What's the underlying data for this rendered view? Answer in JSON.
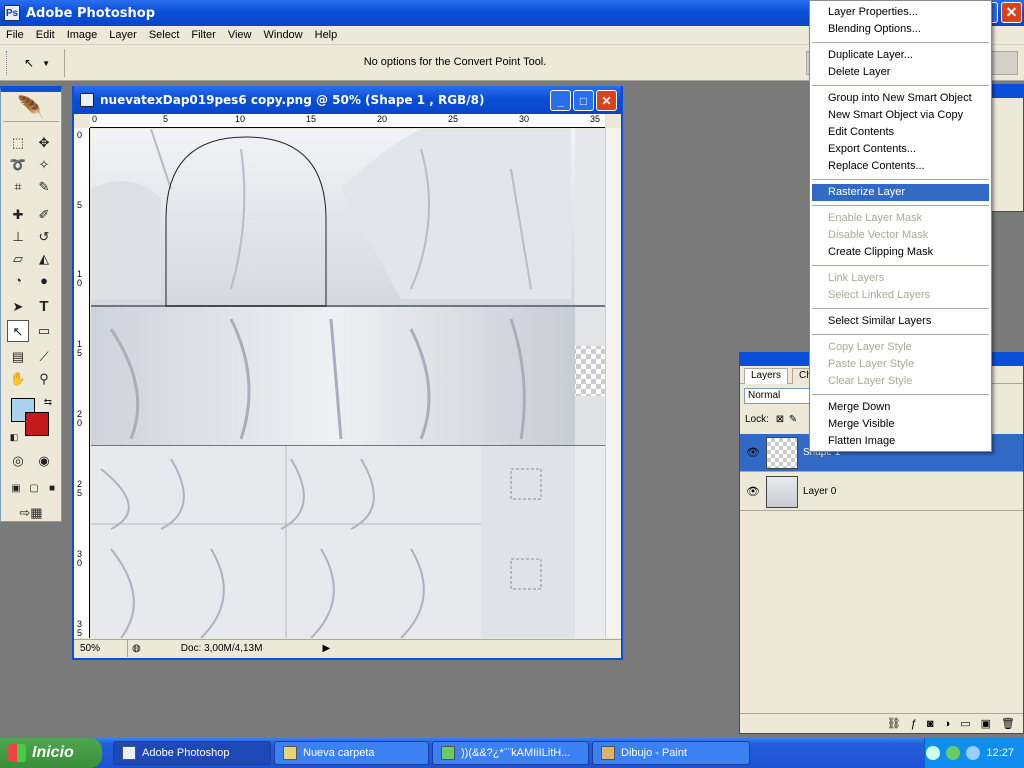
{
  "app": {
    "title": "Adobe Photoshop"
  },
  "menu": [
    "File",
    "Edit",
    "Image",
    "Layer",
    "Select",
    "Filter",
    "View",
    "Window",
    "Help"
  ],
  "options": {
    "message": "No options for the Convert Point Tool."
  },
  "document": {
    "title": "nuevatexDap019pes6 copy.png @ 50% (Shape 1 , RGB/8)",
    "zoom": "50%",
    "doc_size": "Doc: 3,00M/4,13M",
    "ruler_top": [
      "0",
      "5",
      "10",
      "15",
      "20",
      "25",
      "30",
      "35"
    ],
    "ruler_left": [
      "0",
      "5",
      "1\n0",
      "1\n5",
      "2\n0",
      "2\n5",
      "3\n0",
      "3\n5"
    ]
  },
  "colors": {
    "foreground": "#a8d4f0",
    "background": "#c41a1a"
  },
  "layers_panel": {
    "tabs": [
      "Layers",
      "Ch"
    ],
    "blend_mode": "Normal",
    "lock_label": "Lock:",
    "layers": [
      {
        "name": "Shape 1",
        "selected": true
      },
      {
        "name": "Layer 0",
        "selected": false
      }
    ]
  },
  "context_menu": {
    "items": [
      {
        "label": "Layer Properties...",
        "disabled": false
      },
      {
        "label": "Blending Options...",
        "disabled": false
      },
      {
        "sep": true
      },
      {
        "label": "Duplicate Layer...",
        "disabled": false
      },
      {
        "label": "Delete Layer",
        "disabled": false
      },
      {
        "sep": true
      },
      {
        "label": "Group into New Smart Object",
        "disabled": false
      },
      {
        "label": "New Smart Object via Copy",
        "disabled": false
      },
      {
        "label": "Edit Contents",
        "disabled": false
      },
      {
        "label": "Export Contents...",
        "disabled": false
      },
      {
        "label": "Replace Contents...",
        "disabled": false
      },
      {
        "sep": true
      },
      {
        "label": "Rasterize Layer",
        "disabled": false,
        "highlighted": true
      },
      {
        "sep": true
      },
      {
        "label": "Enable Layer Mask",
        "disabled": true
      },
      {
        "label": "Disable Vector Mask",
        "disabled": true
      },
      {
        "label": "Create Clipping Mask",
        "disabled": false
      },
      {
        "sep": true
      },
      {
        "label": "Link Layers",
        "disabled": true
      },
      {
        "label": "Select Linked Layers",
        "disabled": true
      },
      {
        "sep": true
      },
      {
        "label": "Select Similar Layers",
        "disabled": false
      },
      {
        "sep": true
      },
      {
        "label": "Copy Layer Style",
        "disabled": true
      },
      {
        "label": "Paste Layer Style",
        "disabled": true
      },
      {
        "label": "Clear Layer Style",
        "disabled": true
      },
      {
        "sep": true
      },
      {
        "label": "Merge Down",
        "disabled": false
      },
      {
        "label": "Merge Visible",
        "disabled": false
      },
      {
        "label": "Flatten Image",
        "disabled": false
      }
    ]
  },
  "taskbar": {
    "start": "Inicio",
    "tasks": [
      "Adobe Photoshop",
      "Nueva carpeta",
      "))(&&?¿*¨¨kAMIiILitH...",
      "Dibujo - Paint"
    ],
    "clock": "12:27"
  }
}
